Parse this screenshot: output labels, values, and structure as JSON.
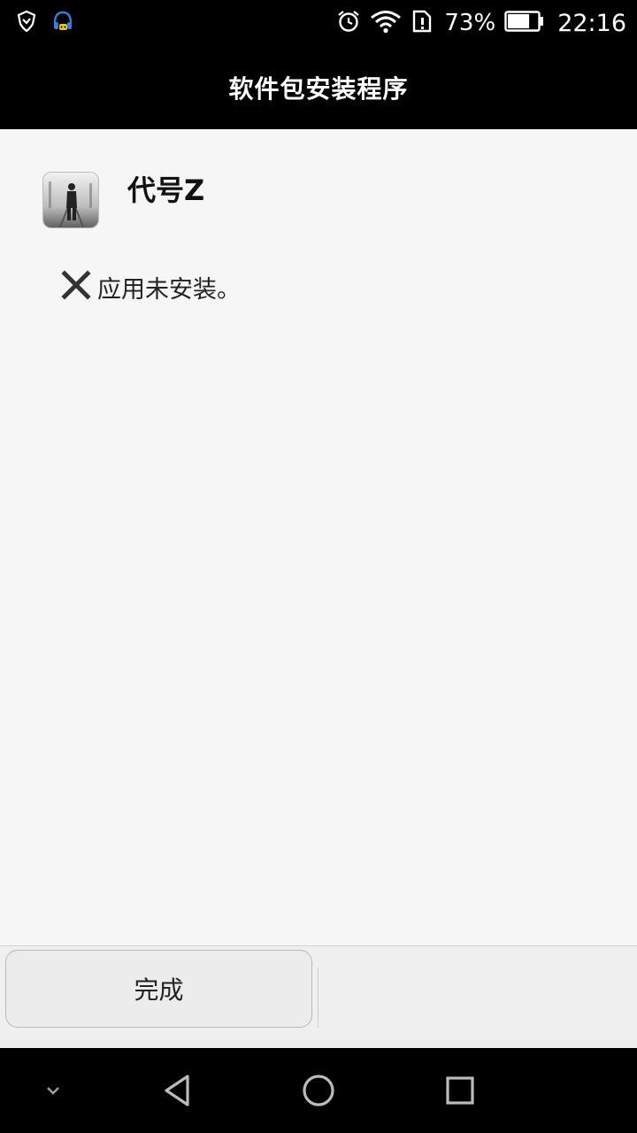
{
  "status_bar": {
    "battery_percent": "73%",
    "time": "22:16",
    "battery_level": 0.73,
    "icons": [
      "shield-icon",
      "headset-notification-icon",
      "alarm-icon",
      "wifi-icon",
      "sim-alert-icon",
      "battery-icon"
    ]
  },
  "header": {
    "title": "软件包安装程序"
  },
  "app": {
    "name": "代号Z",
    "icon": "app-icon-figure-walking"
  },
  "result": {
    "icon": "close-x-icon",
    "message": "应用未安装。"
  },
  "actions": {
    "done_label": "完成"
  },
  "nav": {
    "icons": [
      "chevron-down-icon",
      "back-icon",
      "home-icon",
      "recents-icon"
    ]
  },
  "colors": {
    "status_bar_bg": "#000000",
    "content_bg": "#f6f6f6",
    "bottom_panel_bg": "#efefef",
    "text_dark": "#222222",
    "notification_accent": "#3b7bd8"
  }
}
